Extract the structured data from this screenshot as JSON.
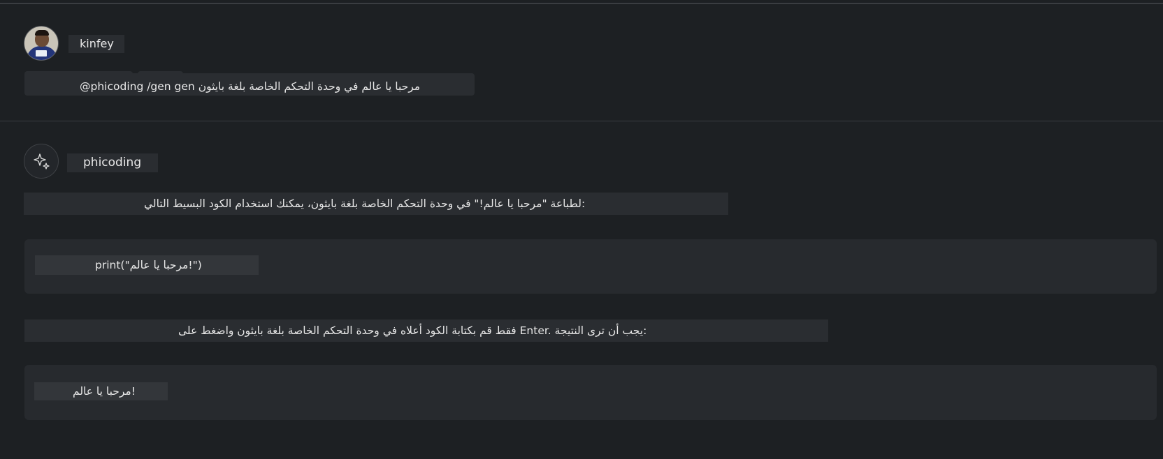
{
  "user": {
    "name": "kinfey",
    "prompt": "@phicoding /gen gen مرحبا يا عالم في وحدة التحكم الخاصة بلغة بايثون"
  },
  "assistant": {
    "name": "phicoding",
    "intro": "لطباعة \"مرحبا يا عالم!\" في وحدة التحكم الخاصة بلغة بايثون، يمكنك استخدام الكود البسيط التالي:",
    "code": "print(\"مرحبا يا عالم!\")",
    "instruction": "فقط قم بكتابة الكود أعلاه في وحدة التحكم الخاصة بلغة بايثون واضغط على Enter. يجب أن ترى النتيجة:",
    "output": "مرحبا يا عالم!"
  },
  "icons": {
    "user_avatar": "user-avatar",
    "assistant": "sparkle-icon"
  }
}
